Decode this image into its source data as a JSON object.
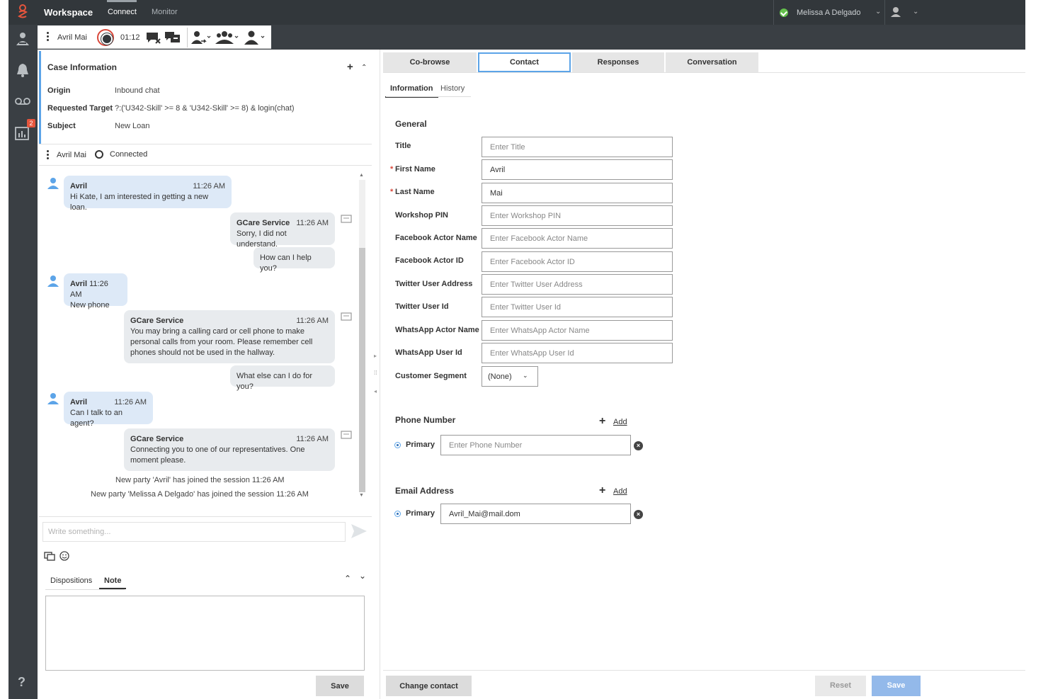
{
  "app": {
    "title": "Workspace",
    "tabs": [
      {
        "label": "Connect",
        "active": true
      },
      {
        "label": "Monitor",
        "active": false
      }
    ],
    "user_name": "Melissa A Delgado",
    "user_status": "ready",
    "colors": {
      "accent": "#5ca4e8",
      "topbar": "#32373b",
      "status_ready": "#64c04c",
      "end_call": "#d9473a"
    }
  },
  "leftnav": {
    "icons": [
      "contacts-icon",
      "notifications-icon",
      "voicemail-icon",
      "reports-icon",
      "help-icon"
    ],
    "reports_badge": "2",
    "help_label": "?"
  },
  "interaction_bar": {
    "party_name": "Avril Mai",
    "timer": "01:12",
    "icons": [
      "end-chat-icon",
      "mark-done-icon",
      "transfer-chat-icon",
      "instant-transfer-icon",
      "conference-icon",
      "consult-icon"
    ]
  },
  "case_info": {
    "title": "Case Information",
    "rows": [
      {
        "key": "Origin",
        "value": "Inbound chat"
      },
      {
        "key": "Requested Target",
        "value": "?:('U342-Skill' >= 8 & 'U342-Skill' >= 8) & login(chat)"
      },
      {
        "key": "Subject",
        "value": "New Loan"
      }
    ]
  },
  "chat": {
    "party_name": "Avril Mai",
    "status": "Connected",
    "messages": [
      {
        "from": "Avril",
        "time": "11:26 AM",
        "text": "Hi Kate, I am interested in getting a new loan.",
        "type": "customer"
      },
      {
        "from": "GCare Service",
        "time": "11:26 AM",
        "text": "Sorry, I did not understand.",
        "type": "agent"
      },
      {
        "from": "",
        "time": "",
        "text": "How can I help you?",
        "type": "agent"
      },
      {
        "from": "Avril",
        "time": "11:26 AM",
        "text": "New phone",
        "type": "customer"
      },
      {
        "from": "GCare Service",
        "time": "11:26 AM",
        "lines": [
          "You may bring a calling card or cell phone to make",
          "personal calls from your room. Please remember cell",
          "phones should not be used in the hallway."
        ],
        "type": "agent"
      },
      {
        "from": "",
        "time": "",
        "text": "What else can I do for you?",
        "type": "agent"
      },
      {
        "from": "Avril",
        "time": "11:26 AM",
        "text": "Can I talk to an agent?",
        "type": "customer"
      },
      {
        "from": "GCare Service",
        "time": "11:26 AM",
        "lines": [
          "Connecting you to one of our representatives. One",
          "moment please."
        ],
        "type": "agent"
      }
    ],
    "system_lines": [
      "New party 'Avril' has joined the session 11:26 AM",
      "New party 'Melissa A Delgado' has joined the session 11:26 AM"
    ],
    "composer_placeholder": "Write something...",
    "composer_value": ""
  },
  "dispositions": {
    "tabs": [
      {
        "label": "Dispositions",
        "active": false
      },
      {
        "label": "Note",
        "active": true
      }
    ],
    "note_value": "",
    "save_label": "Save"
  },
  "contact": {
    "tabs": [
      {
        "label": "Co-browse",
        "active": false
      },
      {
        "label": "Contact",
        "active": true
      },
      {
        "label": "Responses",
        "active": false
      },
      {
        "label": "Conversation",
        "active": false
      }
    ],
    "subtabs": [
      {
        "label": "Information",
        "active": true
      },
      {
        "label": "History",
        "active": false
      }
    ],
    "general_title": "General",
    "fields": [
      {
        "label": "Title",
        "required": false,
        "value": "",
        "placeholder": "Enter Title"
      },
      {
        "label": "First Name",
        "required": true,
        "value": "Avril",
        "placeholder": ""
      },
      {
        "label": "Last Name",
        "required": true,
        "value": "Mai",
        "placeholder": ""
      },
      {
        "label": "Workshop PIN",
        "required": false,
        "value": "",
        "placeholder": "Enter Workshop PIN"
      },
      {
        "label": "Facebook Actor Name",
        "required": false,
        "value": "",
        "placeholder": "Enter Facebook Actor Name"
      },
      {
        "label": "Facebook Actor ID",
        "required": false,
        "value": "",
        "placeholder": "Enter Facebook Actor ID"
      },
      {
        "label": "Twitter User Address",
        "required": false,
        "value": "",
        "placeholder": "Enter Twitter User Address"
      },
      {
        "label": "Twitter User Id",
        "required": false,
        "value": "",
        "placeholder": "Enter Twitter User Id"
      },
      {
        "label": "WhatsApp Actor Name",
        "required": false,
        "value": "",
        "placeholder": "Enter WhatsApp Actor Name"
      },
      {
        "label": "WhatsApp User Id",
        "required": false,
        "value": "",
        "placeholder": "Enter WhatsApp User Id"
      }
    ],
    "customer_segment": {
      "label": "Customer Segment",
      "value": "(None)"
    },
    "phone": {
      "title": "Phone Number",
      "add_label": "Add",
      "primary_label": "Primary",
      "value": "",
      "placeholder": "Enter Phone Number"
    },
    "email": {
      "title": "Email Address",
      "add_label": "Add",
      "primary_label": "Primary",
      "value": "Avril_Mai@mail.dom",
      "placeholder": ""
    },
    "change_contact_label": "Change contact",
    "reset_label": "Reset",
    "save_label": "Save"
  }
}
